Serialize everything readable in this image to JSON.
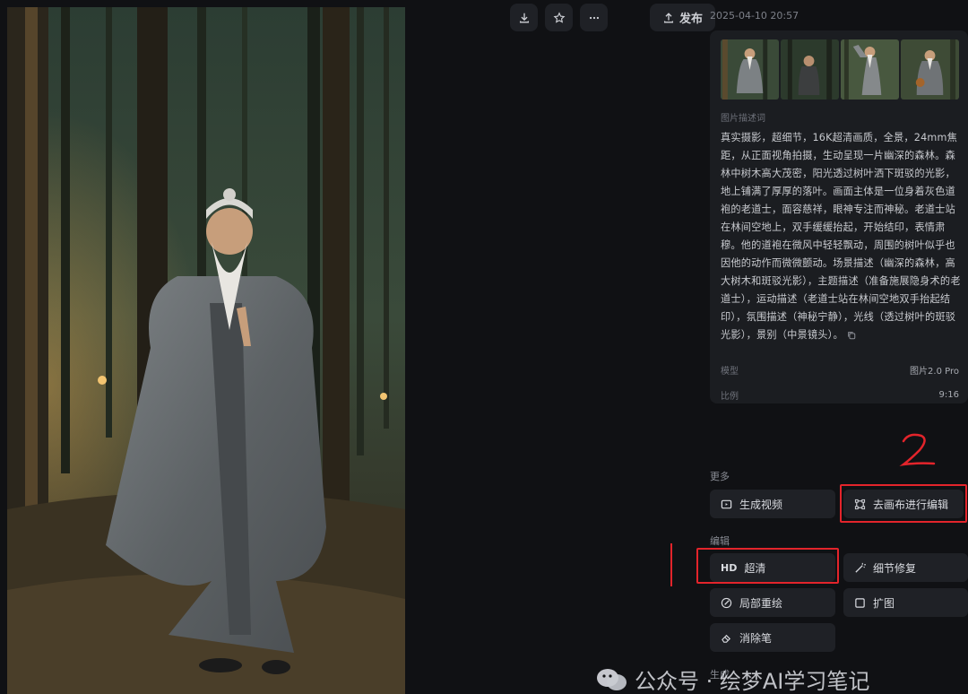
{
  "toolbar": {
    "download_icon": "download-icon",
    "favorite_icon": "star-icon",
    "more_icon": "more-icon",
    "publish_label": "发布"
  },
  "panel": {
    "timestamp": "2025-04-10 20:57",
    "prompt_label": "图片描述词",
    "prompt_text": "真实摄影，超细节，16K超清画质，全景，24mm焦距，从正面视角拍摄，生动呈现一片幽深的森林。森林中树木高大茂密，阳光透过树叶洒下斑驳的光影，地上铺满了厚厚的落叶。画面主体是一位身着灰色道袍的老道士，面容慈祥，眼神专注而神秘。老道士站在林间空地上，双手缓缓抬起，开始结印，表情肃穆。他的道袍在微风中轻轻飘动，周围的树叶似乎也因他的动作而微微颤动。场景描述（幽深的森林，高大树木和斑驳光影），主题描述（准备施展隐身术的老道士），运动描述（老道士站在林间空地双手抬起结印），氛围描述（神秘宁静），光线（透过树叶的斑驳光影），景别（中景镜头）。",
    "model_label": "模型",
    "model_value": "图片2.0 Pro",
    "ratio_label": "比例",
    "ratio_value": "9:16"
  },
  "more_section": {
    "label": "更多",
    "generate_video": "生成视频",
    "canvas_edit": "去画布进行编辑"
  },
  "edit_section": {
    "label": "编辑",
    "hd_prefix": "HD",
    "hd": "超清",
    "detail_fix": "细节修复",
    "inpaint": "局部重绘",
    "expand": "扩图",
    "eraser": "消除笔"
  },
  "generate_section": {
    "label": "生成"
  },
  "annotations": {
    "number_two": "2",
    "color": "#e3242b"
  },
  "watermark": {
    "text": "公众号 · 绘梦AI学习笔记"
  }
}
